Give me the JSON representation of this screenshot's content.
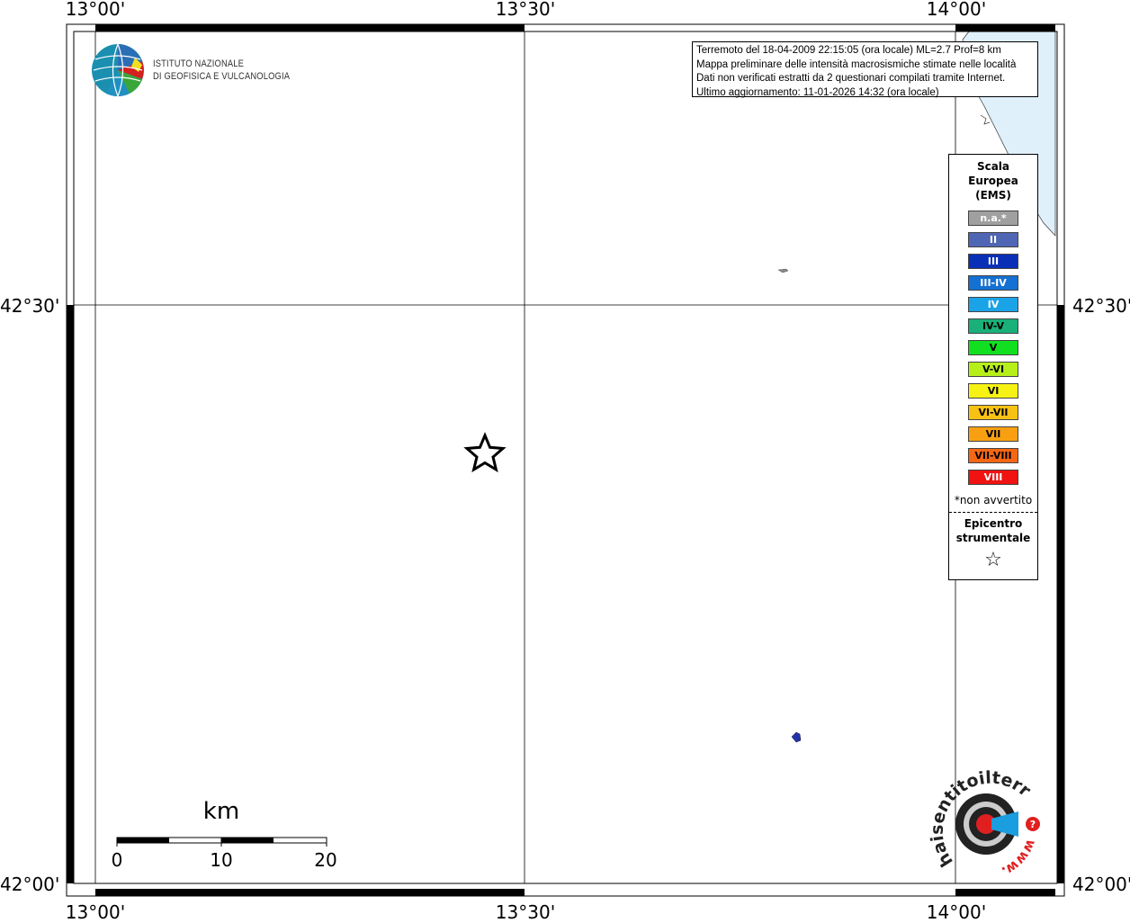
{
  "map": {
    "lon_labels": [
      "13°00'",
      "13°30'",
      "14°00'"
    ],
    "lat_labels": [
      "42°30'",
      "42°00'"
    ],
    "coast_color": "#dff0fb"
  },
  "info": {
    "line1": "Terremoto del 18-04-2009 22:15:05 (ora locale) ML=2.7 Prof=8 km",
    "line2": "Mappa preliminare delle intensità macrosismiche stimate nelle località",
    "line3": "Dati non verificati estratti da 2 questionari compilati tramite Internet.",
    "line4": "Ultimo aggiornamento: 11-01-2026 14:32 (ora locale)"
  },
  "legend": {
    "title": "Scala Europea (EMS)",
    "items": [
      {
        "label": "n.a.*",
        "color": "#a0a0a0",
        "text_color": "#ffffff"
      },
      {
        "label": "II",
        "color": "#4f66b4",
        "text_color": "#ffffff"
      },
      {
        "label": "III",
        "color": "#0a2fb7",
        "text_color": "#ffffff"
      },
      {
        "label": "III-IV",
        "color": "#1470d2",
        "text_color": "#ffffff"
      },
      {
        "label": "IV",
        "color": "#1ba3e8",
        "text_color": "#ffffff"
      },
      {
        "label": "IV-V",
        "color": "#19b07a",
        "text_color": "#000000"
      },
      {
        "label": "V",
        "color": "#10e020",
        "text_color": "#000000"
      },
      {
        "label": "V-VI",
        "color": "#b7ef1a",
        "text_color": "#000000"
      },
      {
        "label": "VI",
        "color": "#f6f214",
        "text_color": "#000000"
      },
      {
        "label": "VI-VII",
        "color": "#f8c214",
        "text_color": "#000000"
      },
      {
        "label": "VII",
        "color": "#f9a012",
        "text_color": "#000000"
      },
      {
        "label": "VII-VIII",
        "color": "#f66714",
        "text_color": "#000000"
      },
      {
        "label": "VIII",
        "color": "#f11212",
        "text_color": "#ffffff"
      }
    ],
    "note": "*non avvertito",
    "epicenter_label": "Epicentro strumentale",
    "epicenter_symbol": "☆"
  },
  "logos": {
    "ingv_line1": "ISTITUTO NAZIONALE",
    "ingv_line2": "DI GEOFISICA E VULCANOLOGIA",
    "hst_text": "haisentitoilterremoto.it",
    "hst_www": "www."
  },
  "scalebar": {
    "unit": "km",
    "labels": [
      "0",
      "10",
      "20"
    ]
  },
  "points": [
    {
      "type": "epicenter",
      "symbol": "☆"
    },
    {
      "type": "locality",
      "intensity": "n.a.*",
      "color": "#a0a0a0"
    },
    {
      "type": "locality",
      "intensity": "II",
      "color": "#2233aa"
    }
  ]
}
